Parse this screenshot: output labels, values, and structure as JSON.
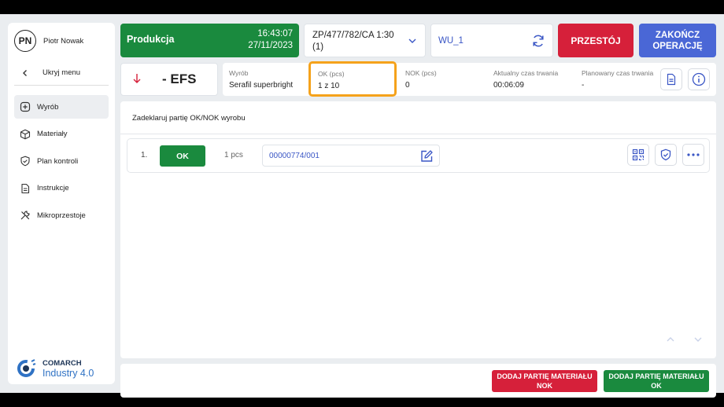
{
  "user": {
    "initials": "PN",
    "name": "Piotr Nowak"
  },
  "menu": {
    "toggle_label": "Ukryj menu",
    "items": [
      {
        "label": "Wyrób",
        "icon": "plus-square-icon",
        "active": true
      },
      {
        "label": "Materiały",
        "icon": "box-icon",
        "active": false
      },
      {
        "label": "Plan kontroli",
        "icon": "shield-check-icon",
        "active": false
      },
      {
        "label": "Instrukcje",
        "icon": "document-icon",
        "active": false
      },
      {
        "label": "Mikroprzestoje",
        "icon": "tools-icon",
        "active": false
      }
    ]
  },
  "logo": {
    "line1": "COMARCH",
    "line2": "Industry 4.0"
  },
  "header": {
    "status": "Produkcja",
    "time": "16:43:07",
    "date": "27/11/2023",
    "order": "ZP/477/782/CA 1:30 (1)",
    "workstation": "WU_1",
    "downtime_label": "PRZESTÓJ",
    "finish_label": "ZAKOŃCZ OPERACJĘ"
  },
  "info": {
    "operation": "- EFS",
    "product_label": "Wyrób",
    "product_value": "Serafil superbright",
    "ok_label": "OK (pcs)",
    "ok_value": "1 z 10",
    "nok_label": "NOK (pcs)",
    "nok_value": "0",
    "current_label": "Aktualny czas trwania",
    "current_value": "00:06:09",
    "planned_label": "Planowany czas trwania",
    "planned_value": "-"
  },
  "main": {
    "title": "Zadeklaruj partię OK/NOK wyrobu",
    "rows": [
      {
        "index": "1.",
        "status": "OK",
        "qty": "1 pcs",
        "batch": "00000774/001"
      }
    ]
  },
  "footer": {
    "add_nok_label": "DODAJ PARTIĘ MATERIAŁU NOK",
    "add_ok_label": "DODAJ PARTIĘ MATERIAŁU OK"
  },
  "colors": {
    "green": "#1a8a3e",
    "red": "#d6203a",
    "blue": "#4a67d6",
    "highlight": "#f5a21b",
    "link": "#3a56c5"
  }
}
